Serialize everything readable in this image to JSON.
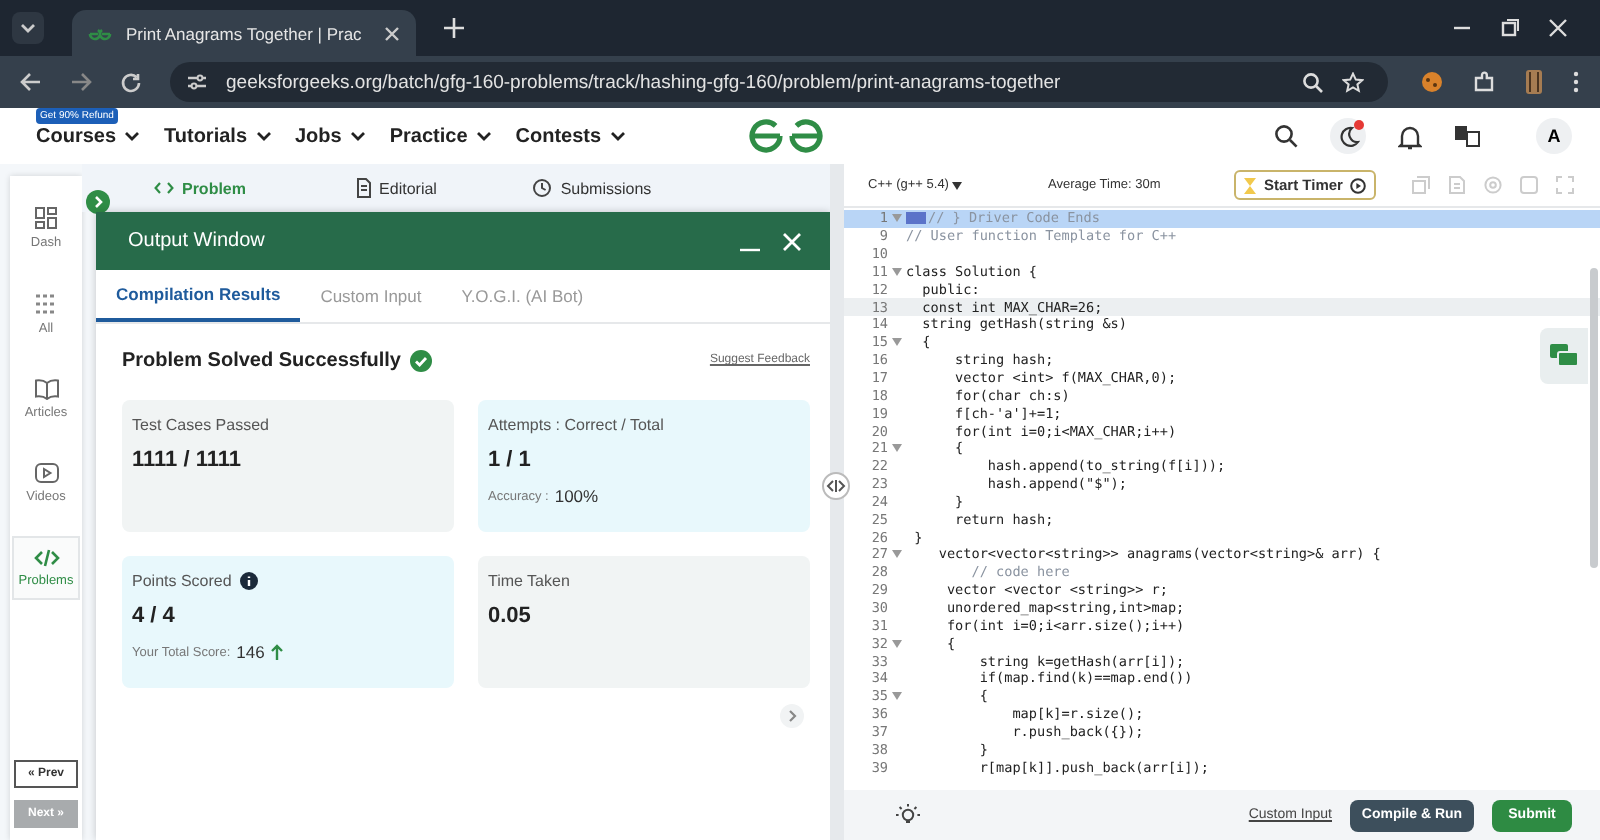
{
  "browser": {
    "tab_title": "Print Anagrams Together | Prac",
    "url": "geeksforgeeks.org/batch/gfg-160-problems/track/hashing-gfg-160/problem/print-anagrams-together"
  },
  "site_nav": {
    "badge": "Get 90% Refund",
    "menus": [
      "Courses",
      "Tutorials",
      "Jobs",
      "Practice",
      "Contests"
    ],
    "avatar": "A",
    "notification_dot": true
  },
  "problem_tabs": [
    {
      "label": "Problem",
      "selected": true
    },
    {
      "label": "Editorial",
      "selected": false
    },
    {
      "label": "Submissions",
      "selected": false
    }
  ],
  "sidebar": {
    "items": [
      {
        "label": "Dash",
        "kind": "dash",
        "selected": false
      },
      {
        "label": "All",
        "kind": "all",
        "selected": false
      },
      {
        "label": "Articles",
        "kind": "articles",
        "selected": false
      },
      {
        "label": "Videos",
        "kind": "videos",
        "selected": false
      },
      {
        "label": "Problems",
        "kind": "problems",
        "selected": true
      }
    ],
    "prev": {
      "label": "« Prev",
      "disabled": false
    },
    "next": {
      "label": "Next »",
      "disabled": true
    }
  },
  "output_window": {
    "title": "Output Window",
    "tabs": [
      {
        "label": "Compilation Results",
        "selected": true
      },
      {
        "label": "Custom Input",
        "selected": false
      },
      {
        "label": "Y.O.G.I. (AI Bot)",
        "selected": false
      }
    ],
    "status": "Problem Solved Successfully",
    "feedback_link": "Suggest Feedback",
    "cards": [
      {
        "title": "Test Cases Passed",
        "value": "1111 / 1111",
        "info": false,
        "color": "#f1f4f4"
      },
      {
        "title": "Attempts : Correct / Total",
        "value": "1 / 1",
        "detail_label": "Accuracy :",
        "detail_value": "100%",
        "info": false,
        "color": "#e8f8fc"
      },
      {
        "title": "Points Scored",
        "value": "4 / 4",
        "detail_label": "Your Total Score:",
        "detail_value": "146",
        "rising": true,
        "info": true,
        "color": "#e8f8fc"
      },
      {
        "title": "Time Taken",
        "value": "0.05",
        "info": false,
        "color": "#f1f4f4"
      }
    ]
  },
  "editor": {
    "language": "C++ (g++ 5.4)",
    "average_time": "Average Time: 30m",
    "timer_button": "Start Timer",
    "lines": [
      {
        "number": "1",
        "code": "// } Driver Code Ends",
        "kind": "comment",
        "fold": true,
        "highlighted": true,
        "cursor": false
      },
      {
        "number": "9",
        "code": "// User function Template for C++",
        "kind": "comment",
        "fold": false,
        "highlighted": false,
        "cursor": false
      },
      {
        "number": "10",
        "fold": false,
        "highlighted": false,
        "cursor": false
      },
      {
        "number": "11",
        "code": "class Solution {",
        "kind": "code",
        "fold": true,
        "highlighted": false,
        "cursor": false
      },
      {
        "number": "12",
        "code": "  public:",
        "kind": "code",
        "fold": false,
        "highlighted": false,
        "cursor": false
      },
      {
        "number": "13",
        "code": "  const int MAX_CHAR=26;",
        "kind": "code",
        "fold": false,
        "highlighted": false,
        "cursor": true
      },
      {
        "number": "14",
        "code": "  string getHash(string &s)",
        "kind": "code",
        "fold": false,
        "highlighted": false,
        "cursor": false
      },
      {
        "number": "15",
        "code": "  {",
        "kind": "code",
        "fold": true,
        "highlighted": false,
        "cursor": false
      },
      {
        "number": "16",
        "code": "      string hash;",
        "kind": "code",
        "fold": false,
        "highlighted": false,
        "cursor": false
      },
      {
        "number": "17",
        "code": "      vector <int> f(MAX_CHAR,0);",
        "kind": "code",
        "fold": false,
        "highlighted": false,
        "cursor": false
      },
      {
        "number": "18",
        "code": "      for(char ch:s)",
        "kind": "code",
        "fold": false,
        "highlighted": false,
        "cursor": false
      },
      {
        "number": "19",
        "code": "      f[ch-'a']+=1;",
        "kind": "code",
        "fold": false,
        "highlighted": false,
        "cursor": false
      },
      {
        "number": "20",
        "code": "      for(int i=0;i<MAX_CHAR;i++)",
        "kind": "code",
        "fold": false,
        "highlighted": false,
        "cursor": false
      },
      {
        "number": "21",
        "code": "      {",
        "kind": "code",
        "fold": true,
        "highlighted": false,
        "cursor": false
      },
      {
        "number": "22",
        "code": "          hash.append(to_string(f[i]));",
        "kind": "code",
        "fold": false,
        "highlighted": false,
        "cursor": false
      },
      {
        "number": "23",
        "code": "          hash.append(\"$\");",
        "kind": "code",
        "fold": false,
        "highlighted": false,
        "cursor": false
      },
      {
        "number": "24",
        "code": "      }",
        "kind": "code",
        "fold": false,
        "highlighted": false,
        "cursor": false
      },
      {
        "number": "25",
        "code": "      return hash;",
        "kind": "code",
        "fold": false,
        "highlighted": false,
        "cursor": false
      },
      {
        "number": "26",
        "code": " }",
        "kind": "code",
        "fold": false,
        "highlighted": false,
        "cursor": false
      },
      {
        "number": "27",
        "code": "    vector<vector<string>> anagrams(vector<string>& arr) {",
        "kind": "code",
        "fold": true,
        "highlighted": false,
        "cursor": false
      },
      {
        "number": "28",
        "code": "        // code here",
        "kind": "comment",
        "fold": false,
        "highlighted": false,
        "cursor": false
      },
      {
        "number": "29",
        "code": "     vector <vector <string>> r;",
        "kind": "code",
        "fold": false,
        "highlighted": false,
        "cursor": false
      },
      {
        "number": "30",
        "code": "     unordered_map<string,int>map;",
        "kind": "code",
        "fold": false,
        "highlighted": false,
        "cursor": false
      },
      {
        "number": "31",
        "code": "     for(int i=0;i<arr.size();i++)",
        "kind": "code",
        "fold": false,
        "highlighted": false,
        "cursor": false
      },
      {
        "number": "32",
        "code": "     {",
        "kind": "code",
        "fold": true,
        "highlighted": false,
        "cursor": false
      },
      {
        "number": "33",
        "code": "         string k=getHash(arr[i]);",
        "kind": "code",
        "fold": false,
        "highlighted": false,
        "cursor": false
      },
      {
        "number": "34",
        "code": "         if(map.find(k)==map.end())",
        "kind": "code",
        "fold": false,
        "highlighted": false,
        "cursor": false
      },
      {
        "number": "35",
        "code": "         {",
        "kind": "code",
        "fold": true,
        "highlighted": false,
        "cursor": false
      },
      {
        "number": "36",
        "code": "             map[k]=r.size();",
        "kind": "code",
        "fold": false,
        "highlighted": false,
        "cursor": false
      },
      {
        "number": "37",
        "code": "             r.push_back({});",
        "kind": "code",
        "fold": false,
        "highlighted": false,
        "cursor": false
      },
      {
        "number": "38",
        "code": "         }",
        "kind": "code",
        "fold": false,
        "highlighted": false,
        "cursor": false
      },
      {
        "number": "39",
        "code": "         r[map[k]].push_back(arr[i]);",
        "kind": "code",
        "fold": false,
        "highlighted": false,
        "cursor": false
      }
    ],
    "custom_input_link": "Custom Input",
    "compile_button": "Compile & Run",
    "submit_button": "Submit"
  }
}
